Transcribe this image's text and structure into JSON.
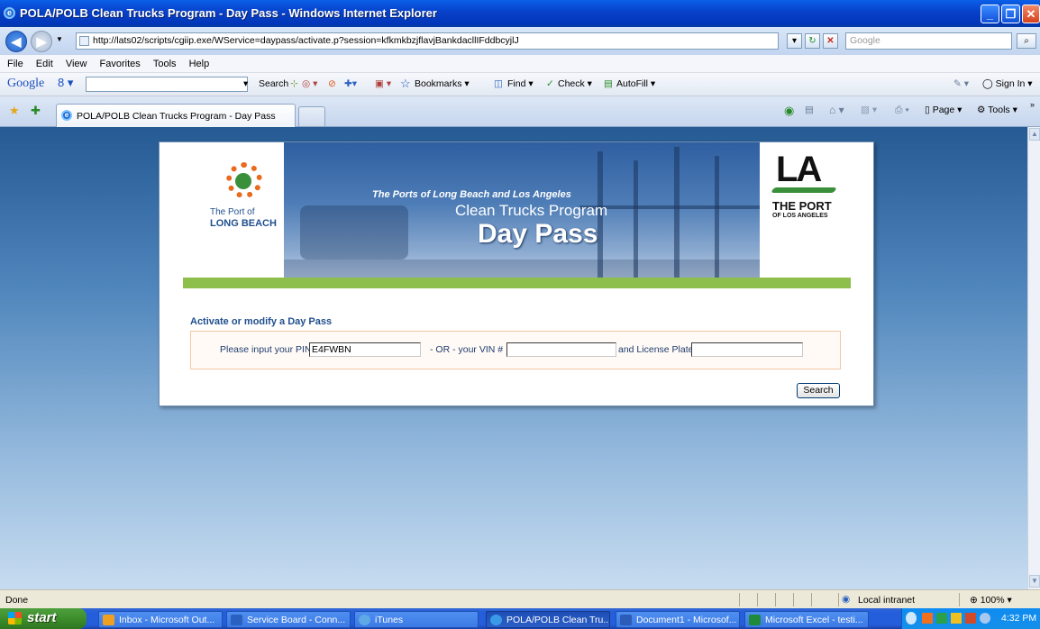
{
  "window": {
    "title": "POLA/POLB Clean Trucks Program - Day Pass - Windows Internet Explorer"
  },
  "address": {
    "url": "http://lats02/scripts/cgiip.exe/WService=daypass/activate.p?session=kfkmkbzjflavjBankdacllIFddbcyjlJ"
  },
  "search": {
    "placeholder": "Google"
  },
  "menu": [
    "File",
    "Edit",
    "View",
    "Favorites",
    "Tools",
    "Help"
  ],
  "google_toolbar": {
    "logo": "Google",
    "search_label": "Search",
    "bookmarks_label": "Bookmarks",
    "find_label": "Find",
    "check_label": "Check",
    "autofill_label": "AutoFill",
    "signin_label": "Sign In"
  },
  "tabs": [
    {
      "label": "POLA/POLB Clean Trucks Program - Day Pass"
    }
  ],
  "command_bar": {
    "page_label": "Page",
    "tools_label": "Tools"
  },
  "banner": {
    "polb_line1": "The Port of",
    "polb_line2": "LONG BEACH",
    "tagline": "The Ports of Long Beach and Los Angeles",
    "program": "Clean Trucks Program",
    "daypass": "Day Pass",
    "la_logo": "LA",
    "la_line1": "THE PORT",
    "la_line2": "OF LOS ANGELES"
  },
  "form": {
    "heading": "Activate or modify a Day Pass",
    "pin_label": "Please input your PIN #",
    "pin_value": "E4FWBN",
    "or_label": "- OR -  your VIN #",
    "vin_value": "",
    "plate_label": "and License Plate",
    "plate_value": "",
    "search_button": "Search"
  },
  "statusbar": {
    "status": "Done",
    "zone": "Local intranet",
    "zoom": "100%"
  },
  "taskbar": {
    "start": "start",
    "items": [
      {
        "label": "Inbox - Microsoft Out...",
        "color": "#f0a020"
      },
      {
        "label": "Service Board - Conn...",
        "color": "#2a60c0"
      },
      {
        "label": "iTunes",
        "color": "#5fa8e8"
      },
      {
        "label": "POLA/POLB Clean Tru...",
        "color": "#3a9ae8"
      },
      {
        "label": "Document1 - Microsof...",
        "color": "#2a5cb8"
      },
      {
        "label": "Microsoft Excel - testi...",
        "color": "#1f8a3a"
      }
    ],
    "clock": "4:32 PM"
  }
}
